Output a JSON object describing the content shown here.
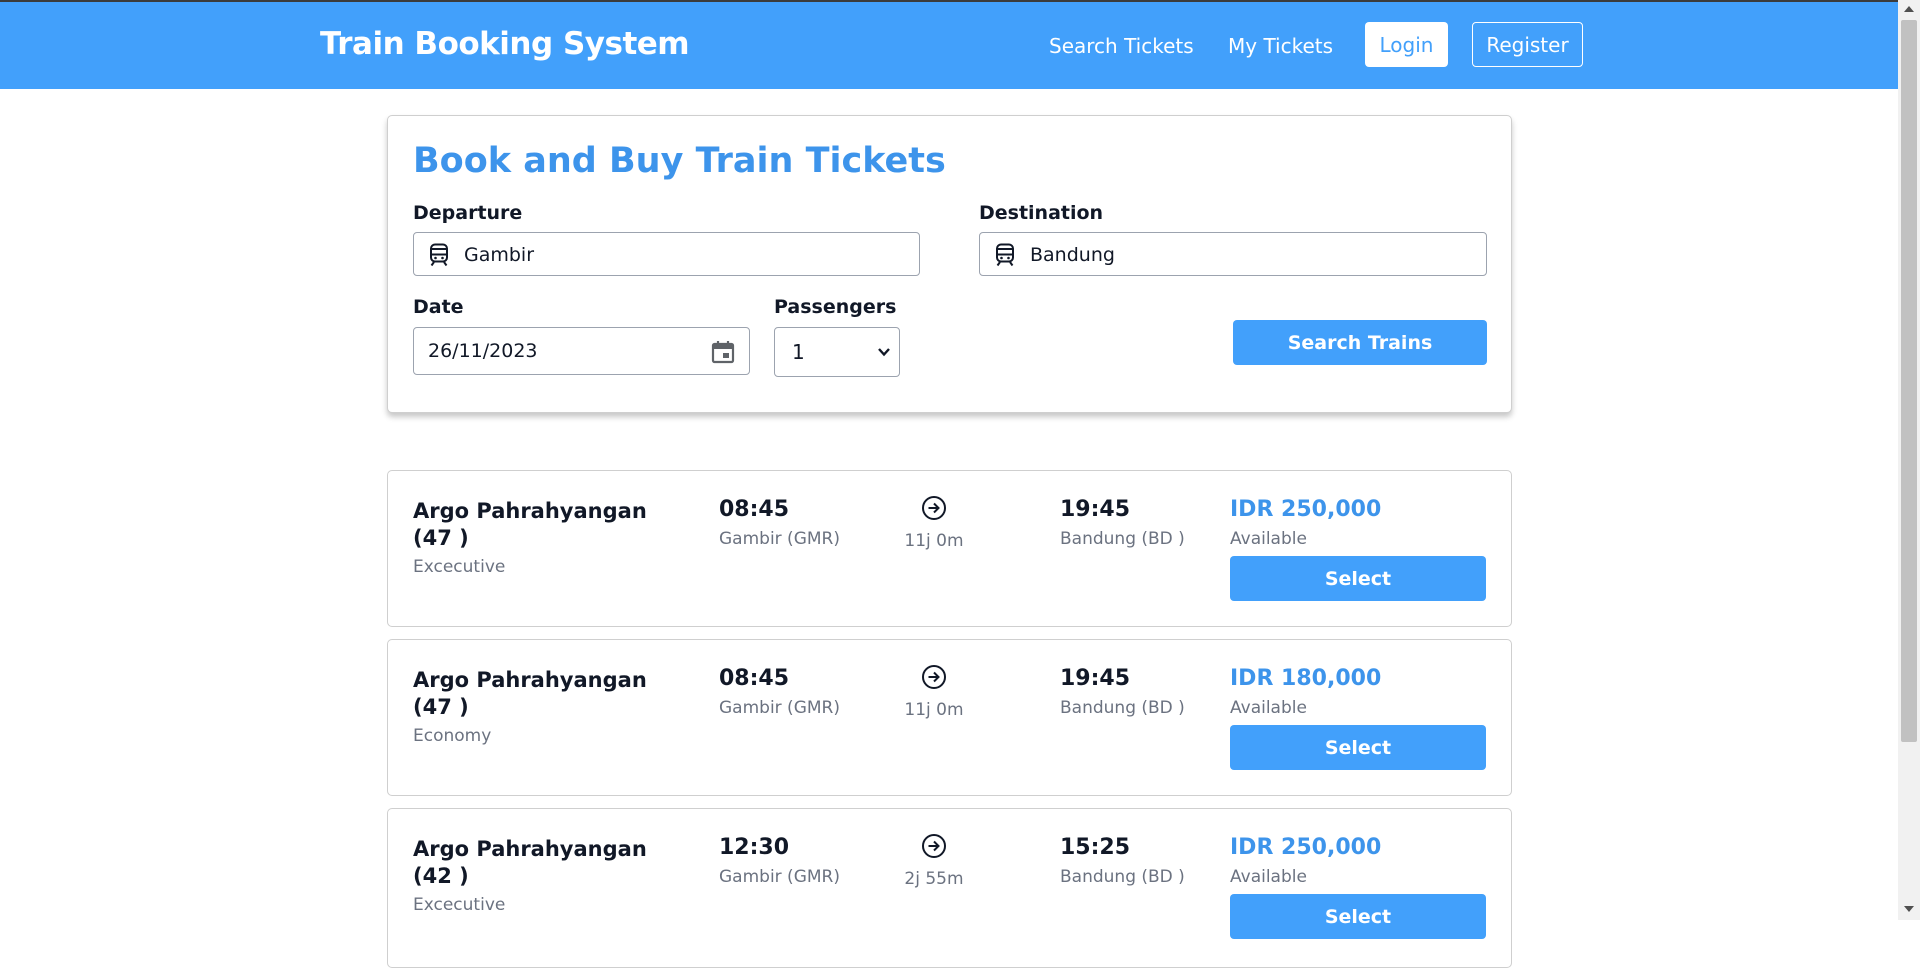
{
  "header": {
    "brand": "Train Booking System",
    "nav_search": "Search Tickets",
    "nav_my_tickets": "My Tickets",
    "login": "Login",
    "register": "Register"
  },
  "search_form": {
    "title": "Book and Buy Train Tickets",
    "departure_label": "Departure",
    "departure_value": "Gambir",
    "destination_label": "Destination",
    "destination_value": "Bandung",
    "date_label": "Date",
    "date_value": "26/11/2023",
    "passengers_label": "Passengers",
    "passengers_value": "1",
    "search_button": "Search Trains"
  },
  "results": [
    {
      "name": "Argo Pahrahyangan (47 )",
      "class": "Excecutive",
      "departure_time": "08:45",
      "departure_station": "Gambir (GMR)",
      "duration": "11j 0m",
      "arrival_time": "19:45",
      "arrival_station": "Bandung (BD )",
      "price": "IDR 250,000",
      "availability": "Available",
      "select_label": "Select"
    },
    {
      "name": "Argo Pahrahyangan (47 )",
      "class": "Economy",
      "departure_time": "08:45",
      "departure_station": "Gambir (GMR)",
      "duration": "11j 0m",
      "arrival_time": "19:45",
      "arrival_station": "Bandung (BD )",
      "price": "IDR 180,000",
      "availability": "Available",
      "select_label": "Select"
    },
    {
      "name": "Argo Pahrahyangan (42 )",
      "class": "Excecutive",
      "departure_time": "12:30",
      "departure_station": "Gambir (GMR)",
      "duration": "2j 55m",
      "arrival_time": "15:25",
      "arrival_station": "Bandung (BD )",
      "price": "IDR 250,000",
      "availability": "Available",
      "select_label": "Select"
    }
  ],
  "colors": {
    "primary": "#42a0fb",
    "accent_text": "#3d94eb"
  },
  "icons": {
    "station": "train-icon",
    "date": "calendar-icon",
    "route": "arrow-right-circle-icon",
    "select": "chevron-down-icon"
  }
}
